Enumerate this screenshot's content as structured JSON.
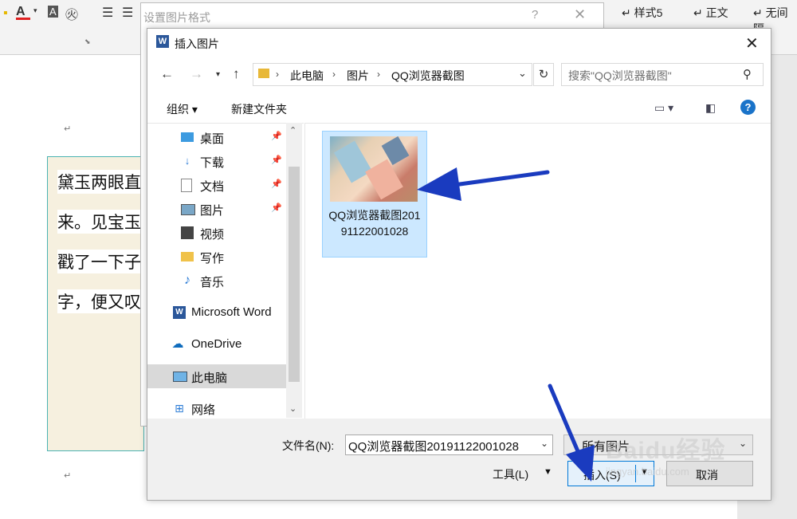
{
  "ribbon": {
    "styles": [
      "样式5",
      "正文",
      "无间隔"
    ],
    "font_color": "#e02020"
  },
  "document": {
    "textbox_lines": [
      "黛玉两眼直",
      "来。见宝玉",
      "戳了一下子",
      "字，便又叹"
    ]
  },
  "format_dialog": {
    "title": "设置图片格式",
    "help": "?",
    "close": "✕"
  },
  "dialog": {
    "title": "插入图片",
    "close": "✕",
    "breadcrumb": [
      "此电脑",
      "图片",
      "QQ浏览器截图"
    ],
    "search_placeholder": "搜索\"QQ浏览器截图\"",
    "toolbar": {
      "organize": "组织 ▾",
      "new_folder": "新建文件夹"
    },
    "nav_items": [
      {
        "label": "桌面",
        "icon": "desktop-icon",
        "pinned": true
      },
      {
        "label": "下载",
        "icon": "download-icon",
        "pinned": true
      },
      {
        "label": "文档",
        "icon": "document-icon",
        "pinned": true
      },
      {
        "label": "图片",
        "icon": "pictures-icon",
        "pinned": true
      },
      {
        "label": "视频",
        "icon": "video-icon",
        "pinned": false
      },
      {
        "label": "写作",
        "icon": "folder-icon",
        "pinned": false
      },
      {
        "label": "音乐",
        "icon": "music-icon",
        "pinned": false
      },
      {
        "label": "Microsoft Word",
        "icon": "word-icon",
        "pinned": false
      },
      {
        "label": "OneDrive",
        "icon": "onedrive-icon",
        "pinned": false
      },
      {
        "label": "此电脑",
        "icon": "computer-icon",
        "pinned": false
      },
      {
        "label": "网络",
        "icon": "network-icon",
        "pinned": false
      }
    ],
    "file": {
      "name": "QQ浏览器截图20191122001028"
    },
    "filename_label": "文件名(N):",
    "filename_value": "QQ浏览器截图20191122001028",
    "filetype_value": "所有图片",
    "tools_label": "工具(L)",
    "insert_label": "插入(S)",
    "cancel_label": "取消"
  },
  "watermark": {
    "main": "Baidu经验",
    "sub": "jingyan.baidu.com"
  },
  "colors": {
    "accent": "#0078d7",
    "annotation_arrow": "#1a3bbf"
  }
}
